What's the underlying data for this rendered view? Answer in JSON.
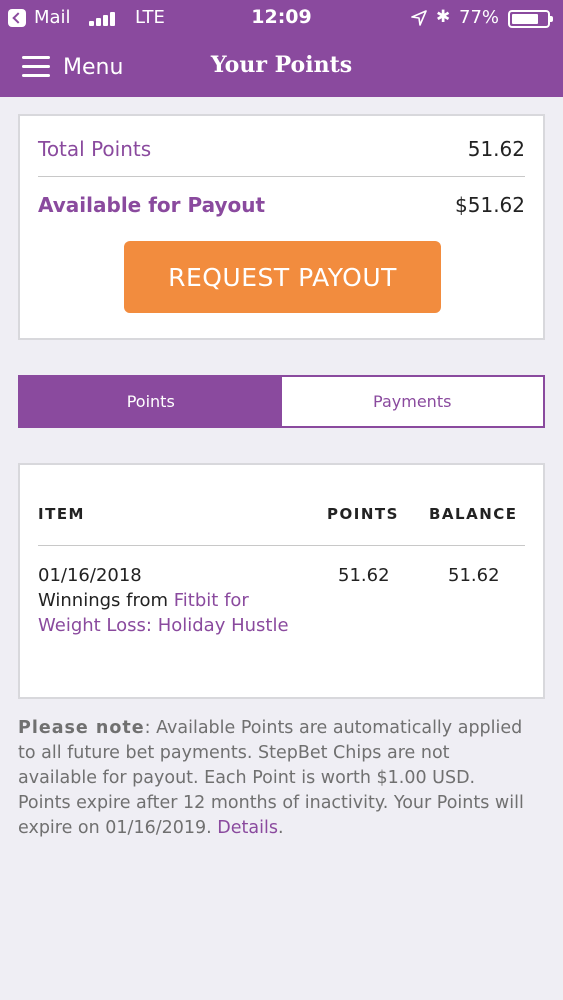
{
  "status_bar": {
    "carrier": "Mail",
    "network": "LTE",
    "time": "12:09",
    "bluetooth_glyph": "✱",
    "battery_percent": "77%",
    "battery_level": 0.77
  },
  "nav": {
    "menu_label": "Menu",
    "title": "Your Points"
  },
  "summary": {
    "total_label": "Total Points",
    "total_value": "51.62",
    "available_label": "Available for Payout",
    "available_value": "$51.62",
    "payout_button": "REQUEST PAYOUT"
  },
  "tabs": [
    {
      "label": "Points",
      "active": true
    },
    {
      "label": "Payments",
      "active": false
    }
  ],
  "table": {
    "headers": {
      "item": "ITEM",
      "points": "POINTS",
      "balance": "BALANCE"
    },
    "rows": [
      {
        "date": "01/16/2018",
        "description_prefix": "Winnings from ",
        "description_link": "Fitbit for Weight Loss: Holiday Hustle",
        "points": "51.62",
        "balance": "51.62"
      }
    ]
  },
  "note": {
    "lead": "Please note",
    "colon": ":",
    "body": " Available Points are automatically applied to all future bet payments. StepBet Chips are not available for payout. Each Point is worth $1.00 USD. Points expire after 12 months of inactivity. Your Points will expire on 01/16/2019. ",
    "link": "Details",
    "end": "."
  },
  "colors": {
    "brand_purple": "#8a4a9e",
    "payout_orange": "#f28c3e",
    "background": "#efeef4"
  },
  "icons": [
    "back-to-app-icon",
    "signal-bars-icon",
    "location-arrow-icon",
    "bluetooth-icon",
    "battery-icon",
    "hamburger-menu-icon"
  ]
}
